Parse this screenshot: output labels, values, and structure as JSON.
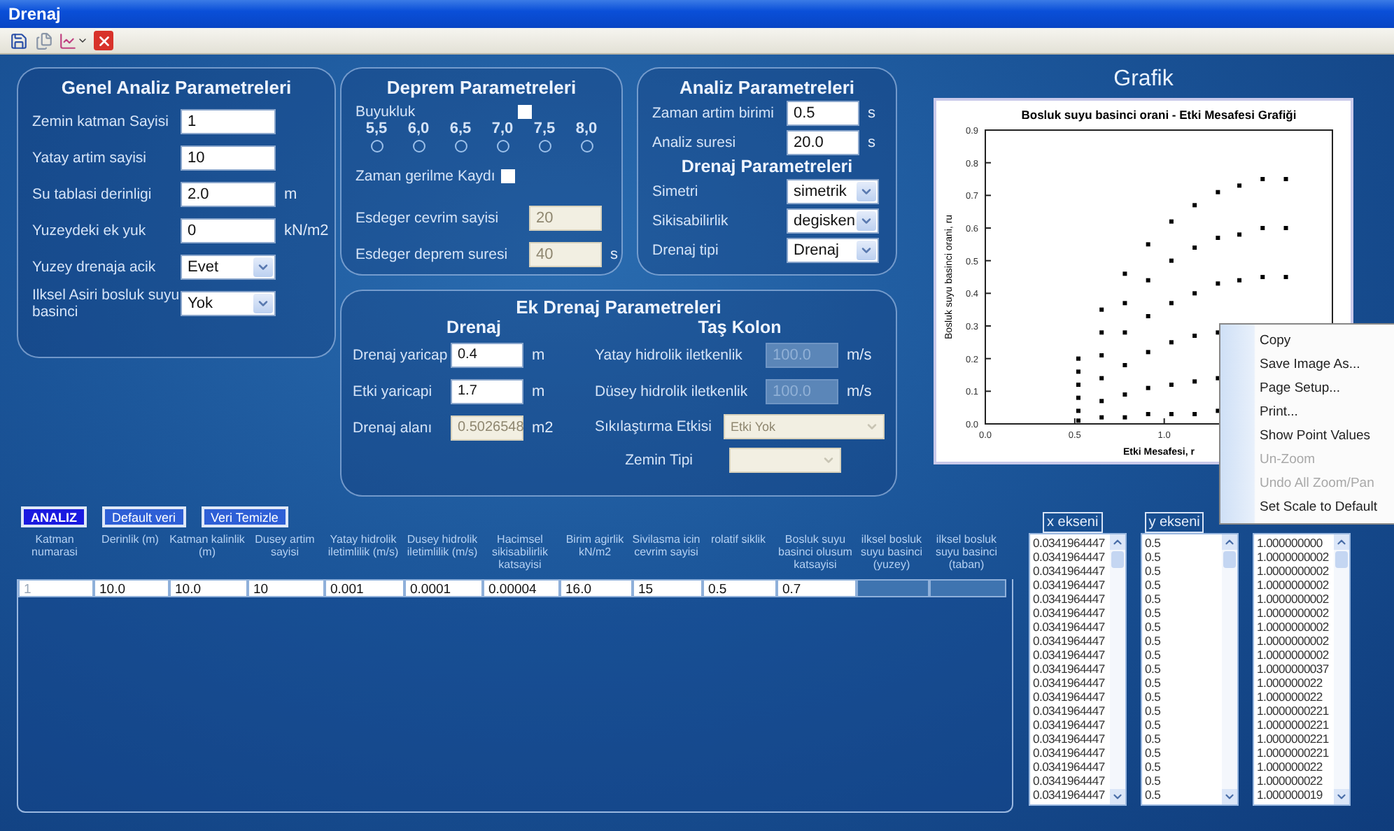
{
  "window": {
    "title": "Drenaj"
  },
  "general_panel": {
    "title": "Genel Analiz Parametreleri",
    "fields": [
      {
        "kind": "input",
        "label": "Zemin katman Sayisi",
        "value": "1",
        "disabled": false
      },
      {
        "kind": "input",
        "label": "Yatay artim sayisi",
        "value": "10",
        "disabled": false
      },
      {
        "kind": "input",
        "label": "Su tablasi derinligi",
        "value": "2.0",
        "unit": "m",
        "disabled": false
      },
      {
        "kind": "input",
        "label": "Yuzeydeki ek yuk",
        "value": "0",
        "unit": "kN/m2",
        "disabled": false
      },
      {
        "kind": "select",
        "label": "Yuzey drenaja acik",
        "value": "Evet",
        "disabled": false
      },
      {
        "kind": "select",
        "label": "Ilksel Asiri bosluk suyu basinci",
        "value": "Yok",
        "disabled": false
      }
    ]
  },
  "earthquake_panel": {
    "title": "Deprem Parametreleri",
    "magnitude": {
      "label": "Buyukluk",
      "checked": false
    },
    "magnitudes": [
      {
        "label": "5,5",
        "selected": false
      },
      {
        "label": "6,0",
        "selected": false
      },
      {
        "label": "6,5",
        "selected": false
      },
      {
        "label": "7,0",
        "selected": false
      },
      {
        "label": "7,5",
        "selected": false
      },
      {
        "label": "8,0",
        "selected": false
      }
    ],
    "time_record": {
      "label": "Zaman gerilme Kaydı",
      "checked": false
    },
    "fields": [
      {
        "kind": "input",
        "label": "Esdeger cevrim sayisi",
        "value": "20",
        "disabled": true
      },
      {
        "kind": "input",
        "label": "Esdeger deprem suresi",
        "value": "40",
        "unit": "s",
        "disabled": true
      }
    ]
  },
  "analysis_panel": {
    "title": "Analiz Parametreleri",
    "fields": [
      {
        "kind": "input",
        "label": "Zaman artim birimi",
        "value": "0.5",
        "unit": "s",
        "disabled": false
      },
      {
        "kind": "input",
        "label": "Analiz suresi",
        "value": "20.0",
        "unit": "s",
        "disabled": false
      }
    ],
    "subtitle": "Drenaj Parametreleri",
    "drain_fields": [
      {
        "kind": "select",
        "label": "Simetri",
        "value": "simetrik",
        "disabled": false
      },
      {
        "kind": "select",
        "label": "Sikisabilirlik",
        "value": "degisken",
        "disabled": false
      },
      {
        "kind": "select",
        "label": "Drenaj tipi",
        "value": "Drenaj",
        "disabled": false
      }
    ]
  },
  "extra_drain_panel": {
    "title": "Ek Drenaj Parametreleri",
    "drain": {
      "title": "Drenaj",
      "fields": [
        {
          "kind": "input",
          "label": "Drenaj yaricap",
          "value": "0.4",
          "unit": "m",
          "disabled": false
        },
        {
          "kind": "input",
          "label": "Etki yaricapi",
          "value": "1.7",
          "unit": "m",
          "disabled": false
        },
        {
          "kind": "input",
          "label": "Drenaj alanı",
          "value": "0.5026548",
          "unit": "m2",
          "disabled": true
        }
      ]
    },
    "stone_column": {
      "title": "Taş Kolon",
      "fields": [
        {
          "kind": "input",
          "label": "Yatay hidrolik iletkenlik",
          "value": "100.0",
          "unit": "m/s",
          "disabled": true
        },
        {
          "kind": "input",
          "label": "Düsey hidrolik iletkenlik",
          "value": "100.0",
          "unit": "m/s",
          "disabled": true
        },
        {
          "kind": "select",
          "label": "Sıkılaştırma Etkisi",
          "value": "Etki Yok",
          "disabled": true
        },
        {
          "kind": "select",
          "label": "Zemin Tipi",
          "disabled": true
        }
      ]
    }
  },
  "buttons": [
    {
      "label": "ANALIZ",
      "kind": "primary"
    },
    {
      "label": "Default veri",
      "kind": "secondary"
    },
    {
      "label": "Veri Temizle",
      "kind": "secondary"
    }
  ],
  "table": {
    "columns": [
      "Katman numarasi",
      "Derinlik (m)",
      "Katman kalinlik (m)",
      "Dusey artim sayisi",
      "Yatay hidrolik iletimlilik (m/s)",
      "Dusey hidrolik iletimlilik (m/s)",
      "Hacimsel sikisabilirlik katsayisi",
      "Birim agirlik kN/m2",
      "Sivilasma icin cevrim sayisi",
      "rolatif siklik",
      "Bosluk suyu basinci olusum katsayisi",
      "ilksel bosluk suyu basinci (yuzey)",
      "ilksel bosluk suyu basinci (taban)"
    ],
    "rows": [
      {
        "cells": [
          "1",
          "10.0",
          "10.0",
          "10",
          "0.001",
          "0.0001",
          "0.00004",
          "16.0",
          "15",
          "0.5",
          "0.7"
        ]
      }
    ]
  },
  "graph": {
    "title": "Grafik",
    "chart_data": {
      "type": "scatter",
      "title": "Bosluk suyu basinci orani - Etki Mesafesi Grafiği",
      "xlabel": "Etki Mesafesi, r",
      "ylabel": "Bosluk suyu basinci orani, ru",
      "xlim": [
        0,
        1.94
      ],
      "ylim": [
        0,
        0.9
      ],
      "xticks": [
        {
          "value": 0,
          "label": "0.0"
        },
        {
          "value": 0.5,
          "label": "0.5"
        },
        {
          "value": 1,
          "label": "1.0"
        }
      ],
      "yticks": [
        {
          "value": 0,
          "label": "0.0"
        },
        {
          "value": 0.1,
          "label": "0.1"
        },
        {
          "value": 0.2,
          "label": "0.2"
        },
        {
          "value": 0.3,
          "label": "0.3"
        },
        {
          "value": 0.4,
          "label": "0.4"
        },
        {
          "value": 0.5,
          "label": "0.5"
        },
        {
          "value": 0.6,
          "label": "0.6"
        },
        {
          "value": 0.7,
          "label": "0.7"
        },
        {
          "value": 0.8,
          "label": "0.8"
        },
        {
          "value": 0.9,
          "label": "0.9"
        }
      ],
      "x": [
        0.52,
        0.52,
        0.52,
        0.52,
        0.52,
        0.52,
        0.65,
        0.65,
        0.65,
        0.65,
        0.65,
        0.65,
        0.78,
        0.78,
        0.78,
        0.78,
        0.78,
        0.78,
        0.91,
        0.91,
        0.91,
        0.91,
        0.91,
        0.91,
        1.04,
        1.04,
        1.04,
        1.04,
        1.04,
        1.04,
        1.17,
        1.17,
        1.17,
        1.17,
        1.17,
        1.17,
        1.3,
        1.3,
        1.3,
        1.3,
        1.3,
        1.3,
        1.42,
        1.42,
        1.42,
        1.55,
        1.55,
        1.55,
        1.68,
        1.68,
        1.68
      ],
      "series": [
        {
          "color": "#000000",
          "values": [
            0.2,
            0.16,
            0.12,
            0.08,
            0.04,
            0.01,
            0.35,
            0.28,
            0.21,
            0.14,
            0.07,
            0.02,
            0.46,
            0.37,
            0.28,
            0.18,
            0.09,
            0.02,
            0.55,
            0.44,
            0.33,
            0.22,
            0.11,
            0.03,
            0.62,
            0.5,
            0.37,
            0.25,
            0.12,
            0.03,
            0.67,
            0.54,
            0.4,
            0.27,
            0.13,
            0.03,
            0.71,
            0.57,
            0.43,
            0.28,
            0.14,
            0.04,
            0.73,
            0.58,
            0.44,
            0.75,
            0.6,
            0.45,
            0.75,
            0.6,
            0.45
          ]
        }
      ]
    },
    "axis_labels": [
      "x ekseni",
      "y ekseni"
    ],
    "lists": [
      [
        "0.0341964447",
        "0.0341964447",
        "0.0341964447",
        "0.0341964447",
        "0.0341964447",
        "0.0341964447",
        "0.0341964447",
        "0.0341964447",
        "0.0341964447",
        "0.0341964447",
        "0.0341964447",
        "0.0341964447",
        "0.0341964447",
        "0.0341964447",
        "0.0341964447",
        "0.0341964447",
        "0.0341964447",
        "0.0341964447",
        "0.0341964447"
      ],
      [
        "0.5",
        "0.5",
        "0.5",
        "0.5",
        "0.5",
        "0.5",
        "0.5",
        "0.5",
        "0.5",
        "0.5",
        "0.5",
        "0.5",
        "0.5",
        "0.5",
        "0.5",
        "0.5",
        "0.5",
        "0.5",
        "0.5"
      ],
      [
        "1.000000000",
        "1.0000000002",
        "1.0000000002",
        "1.0000000002",
        "1.0000000002",
        "1.0000000002",
        "1.0000000002",
        "1.0000000002",
        "1.0000000002",
        "1.0000000037",
        "1.000000022",
        "1.000000022",
        "1.0000000221",
        "1.0000000221",
        "1.0000000221",
        "1.0000000221",
        "1.000000022",
        "1.000000022",
        "1.000000019"
      ]
    ]
  },
  "context_menu": [
    {
      "label": "Copy",
      "disabled": false
    },
    {
      "label": "Save Image As...",
      "disabled": false
    },
    {
      "label": "Page Setup...",
      "disabled": false
    },
    {
      "label": "Print...",
      "disabled": false
    },
    {
      "label": "Show Point Values",
      "disabled": false
    },
    {
      "label": "Un-Zoom",
      "disabled": true
    },
    {
      "label": "Undo All Zoom/Pan",
      "disabled": true
    },
    {
      "label": "Set Scale to Default",
      "disabled": false
    }
  ]
}
